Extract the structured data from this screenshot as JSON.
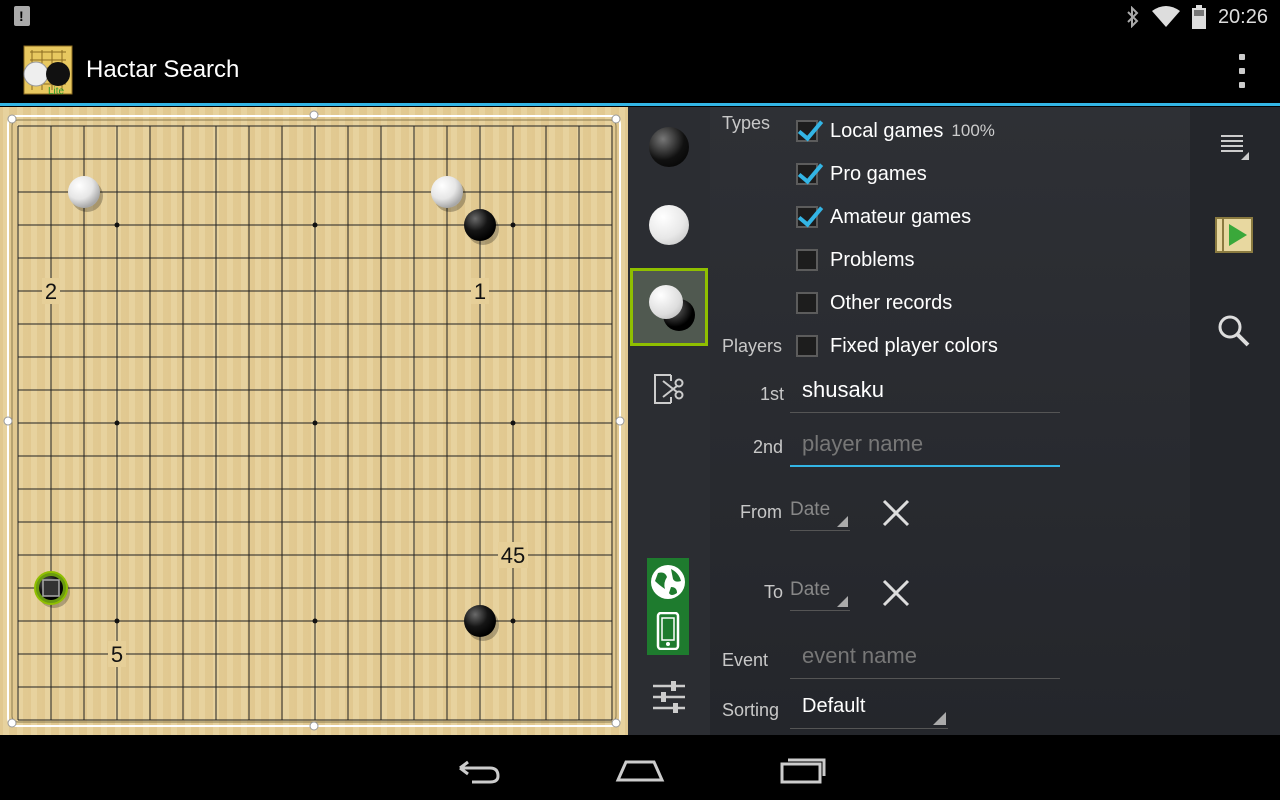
{
  "status_bar": {
    "time": "20:26",
    "icons": [
      "notification-icon",
      "bluetooth-icon",
      "wifi-icon",
      "battery-icon"
    ]
  },
  "app": {
    "title": "Hactar Search",
    "icon_badge": "Lite"
  },
  "board": {
    "size": 19,
    "stones": [
      {
        "color": "white",
        "col": 3,
        "row": 3
      },
      {
        "color": "white",
        "col": 14,
        "row": 3
      },
      {
        "color": "black",
        "col": 15,
        "row": 4
      },
      {
        "color": "black",
        "col": 15,
        "row": 16
      },
      {
        "color": "black-marked",
        "col": 2,
        "row": 15
      }
    ],
    "labels": [
      {
        "text": "2",
        "col": 2,
        "row": 6
      },
      {
        "text": "1",
        "col": 15,
        "row": 6
      },
      {
        "text": "45",
        "col": 16,
        "row": 14
      },
      {
        "text": "5",
        "col": 4,
        "row": 17
      }
    ]
  },
  "tools": [
    "black-stone-tool",
    "white-stone-tool",
    "alternate-stones-tool",
    "cut-region-tool",
    "source-world-phone",
    "settings-sliders"
  ],
  "form": {
    "types_label": "Types",
    "types": [
      {
        "label": "Local games",
        "checked": true,
        "percent": "100%"
      },
      {
        "label": "Pro games",
        "checked": true
      },
      {
        "label": "Amateur games",
        "checked": true
      },
      {
        "label": "Problems",
        "checked": false
      },
      {
        "label": "Other records",
        "checked": false
      }
    ],
    "players_label": "Players",
    "fixed_colors": {
      "label": "Fixed player colors",
      "checked": false
    },
    "first_label": "1st",
    "first_value": "shusaku",
    "second_label": "2nd",
    "second_placeholder": "player name",
    "from_label": "From",
    "from_value": "Date",
    "to_label": "To",
    "to_value": "Date",
    "event_label": "Event",
    "event_placeholder": "event name",
    "sorting_label": "Sorting",
    "sorting_value": "Default"
  },
  "actions": [
    "list-menu-icon",
    "play-results-icon",
    "search-icon"
  ],
  "colors": {
    "accent": "#33b5e5",
    "board": "#e6cf98",
    "highlight": "#8fbf00",
    "source_green": "#1e7b2e"
  }
}
